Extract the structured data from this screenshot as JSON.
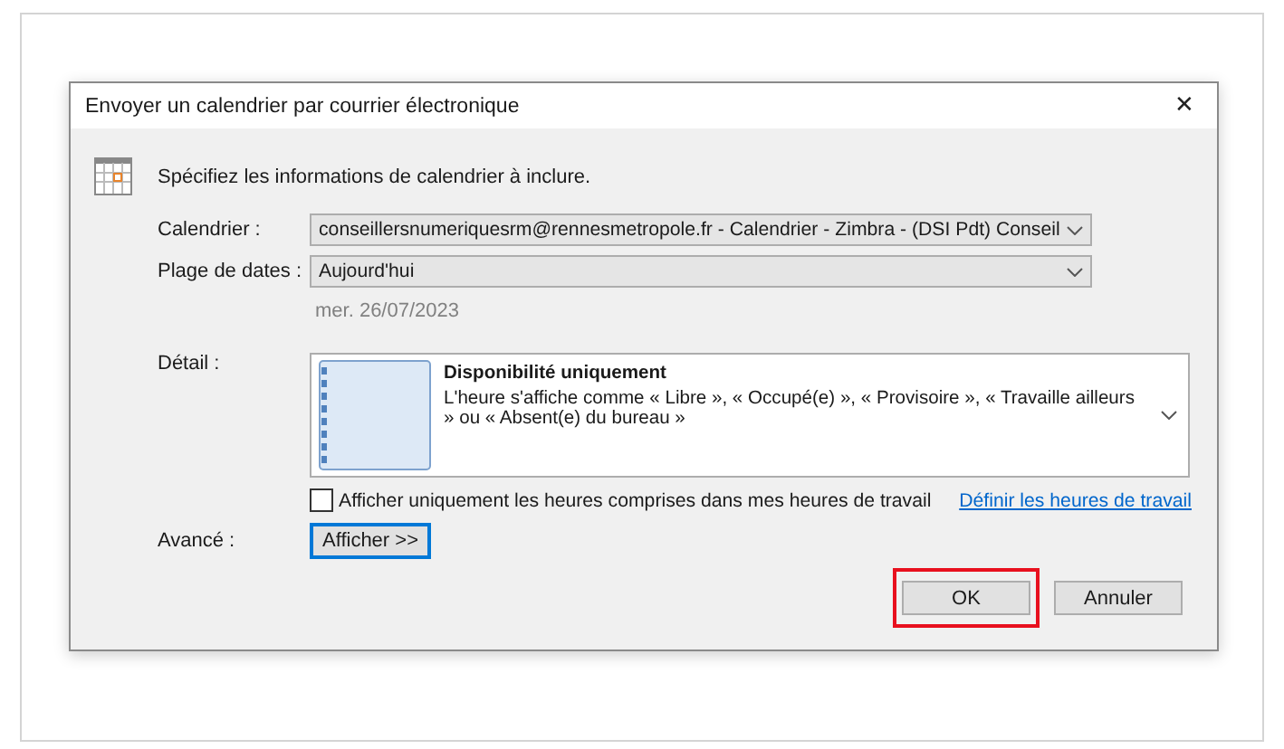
{
  "window": {
    "title": "Envoyer un calendrier par courrier électronique",
    "close": "✕"
  },
  "intro": "Spécifiez les informations de calendrier à inclure.",
  "calendar": {
    "label": "Calendrier :",
    "value": "conseillersnumeriquesrm@rennesmetropole.fr - Calendrier - Zimbra - (DSI Pdt) Conseil"
  },
  "date_range": {
    "label": "Plage de dates :",
    "value": "Aujourd'hui",
    "date": "mer. 26/07/2023"
  },
  "detail": {
    "label": "Détail :",
    "title": "Disponibilité uniquement",
    "description": "L'heure s'affiche comme « Libre », « Occupé(e) », « Provisoire », « Travaille ailleurs » ou « Absent(e) du bureau »"
  },
  "work_hours": {
    "label": "Afficher uniquement les heures comprises dans mes heures de travail",
    "checked": false,
    "link": "Définir les heures de travail"
  },
  "advanced": {
    "label": "Avancé :",
    "button": "Afficher >>"
  },
  "buttons": [
    {
      "label": "OK",
      "highlighted": true
    },
    {
      "label": "Annuler",
      "highlighted": false
    }
  ]
}
